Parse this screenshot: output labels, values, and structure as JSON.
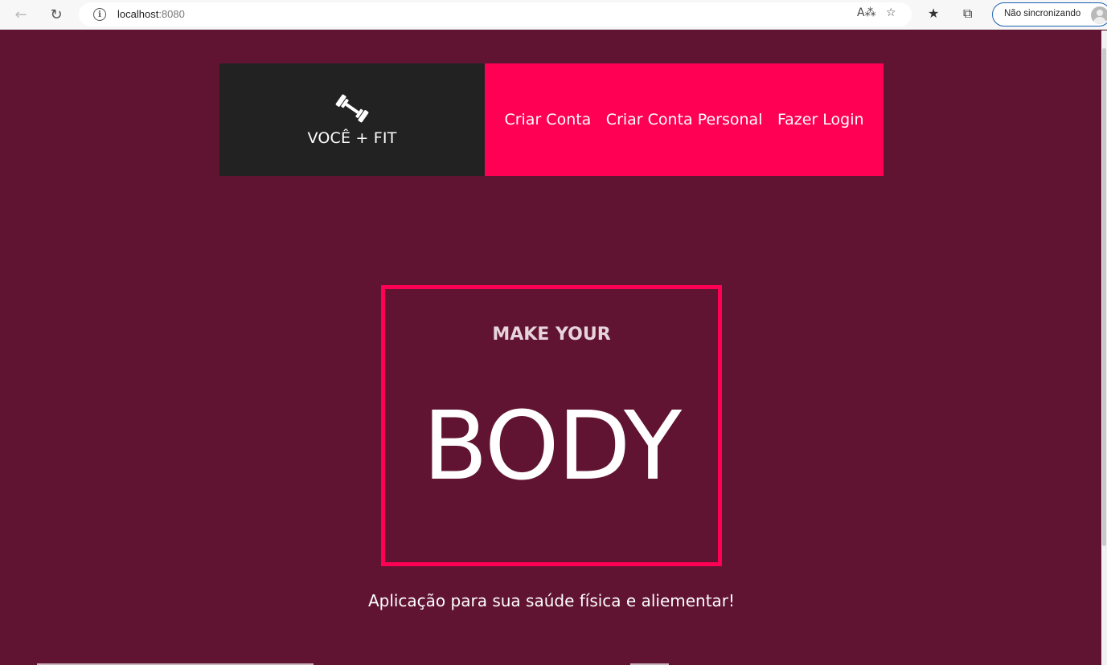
{
  "browser": {
    "url_host": "localhost",
    "url_port": ":8080",
    "profile_label": "Não sincronizando"
  },
  "navbar": {
    "brand": "VOCÊ + FIT",
    "links": [
      {
        "label": "Criar Conta"
      },
      {
        "label": "Criar Conta Personal"
      },
      {
        "label": "Fazer Login"
      }
    ]
  },
  "hero": {
    "subtitle": "MAKE YOUR",
    "title": "BODY"
  },
  "tagline": "Aplicação para sua saúde física e aliementar!",
  "colors": {
    "page_bg": "#611432",
    "accent": "#ff0055",
    "brand_bg": "#222222"
  },
  "icons": {
    "brand_icon": "dumbbell-icon"
  }
}
